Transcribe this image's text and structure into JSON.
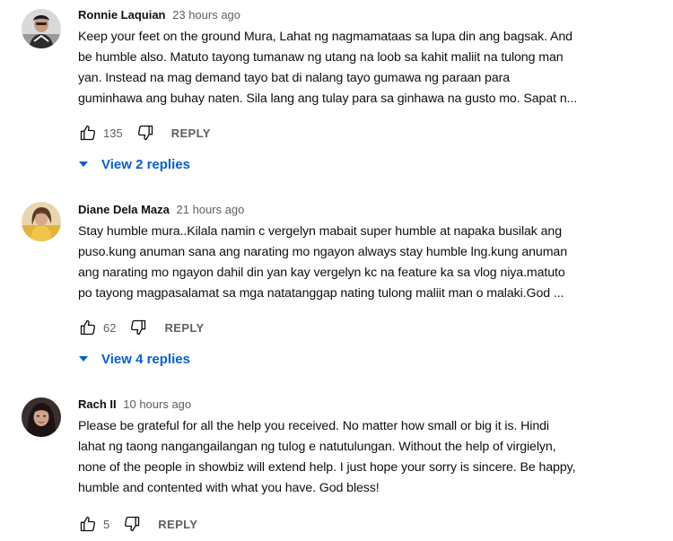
{
  "comments": [
    {
      "author": "Ronnie Laquian",
      "time": "23 hours ago",
      "text_lines": [
        "Keep your feet on the ground Mura, Lahat ng nagmamataas sa lupa din ang bagsak. And",
        "be humble also. Matuto tayong tumanaw ng utang na loob sa kahit maliit na tulong man",
        "yan. Instead na mag demand tayo bat di nalang tayo gumawa ng paraan para",
        "guminhawa ang buhay naten. Sila lang ang tulay para sa ginhawa na gusto mo. Sapat n..."
      ],
      "likes": "135",
      "reply_label": "REPLY",
      "replies_label": "View 2 replies"
    },
    {
      "author": "Diane Dela Maza",
      "time": "21 hours ago",
      "text_lines": [
        "Stay humble mura..Kilala namin c vergelyn mabait super humble at napaka busilak ang",
        "puso.kung anuman sana ang narating mo ngayon always stay humble lng.kung anuman",
        "ang narating mo ngayon dahil din yan kay vergelyn kc na feature ka sa vlog niya.matuto",
        "po tayong magpasalamat sa mga natatanggap nating tulong maliit man o malaki.God ..."
      ],
      "likes": "62",
      "reply_label": "REPLY",
      "replies_label": "View 4 replies"
    },
    {
      "author": "Rach II",
      "time": "10 hours ago",
      "text_lines": [
        "Please be grateful for all the help you received. No matter how small or big it is. Hindi",
        "lahat ng taong nangangailangan ng tulog e natutulungan. Without the help of virgielyn,",
        "none of the people in showbiz will extend help. I just hope your sorry is sincere. Be happy,",
        "humble and contented with what you have. God bless!"
      ],
      "likes": "5",
      "reply_label": "REPLY"
    }
  ],
  "colors": {
    "link": "#065fd4",
    "secondary_text": "#606060",
    "primary_text": "#0f0f0f"
  },
  "icons": {
    "like": "thumb-up-icon",
    "dislike": "thumb-down-icon",
    "expand": "caret-down-icon"
  }
}
